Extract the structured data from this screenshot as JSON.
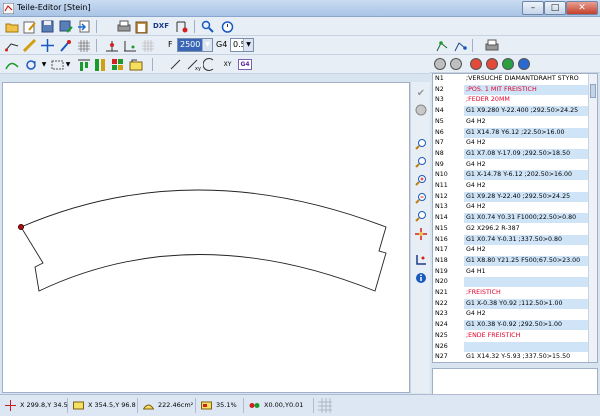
{
  "window": {
    "title": "Teile-Editor [Stein]"
  },
  "toolbar": {
    "feed_label": "F",
    "feed_value": "2500",
    "g4_label": "G4",
    "g4_value": "0.5",
    "dxf_label": "DXF",
    "xy_label": "XY",
    "g4_button_label": "G4"
  },
  "nc_list": {
    "rows": [
      {
        "n": "N1",
        "text": ";VERSUCHE DIAMANTDRAHT  STYRO",
        "red": false,
        "alt": false
      },
      {
        "n": "N2",
        "text": ";POS. 1 MIT FREISTICH",
        "red": true,
        "alt": true
      },
      {
        "n": "N3",
        "text": ";FEDER 20MM",
        "red": true,
        "alt": false
      },
      {
        "n": "N4",
        "text": "G1 X9.280 Y-22.400 ;292.50>24.25",
        "red": false,
        "alt": true
      },
      {
        "n": "N5",
        "text": "G4 H2",
        "red": false,
        "alt": false
      },
      {
        "n": "N6",
        "text": "G1 X14.78 Y6.12 ;22.50>16.00",
        "red": false,
        "alt": true
      },
      {
        "n": "N7",
        "text": "G4 H2",
        "red": false,
        "alt": false
      },
      {
        "n": "N8",
        "text": "G1 X7.08 Y-17.09 ;292.50>18.50",
        "red": false,
        "alt": true
      },
      {
        "n": "N9",
        "text": "G4 H2",
        "red": false,
        "alt": false
      },
      {
        "n": "N10",
        "text": "G1 X-14.78 Y-6.12 ;202.50>16.00",
        "red": false,
        "alt": true
      },
      {
        "n": "N11",
        "text": "G4 H2",
        "red": false,
        "alt": false
      },
      {
        "n": "N12",
        "text": "G1 X9.28 Y-22.40 ;292.50>24.25",
        "red": false,
        "alt": true
      },
      {
        "n": "N13",
        "text": "G4 H2",
        "red": false,
        "alt": false
      },
      {
        "n": "N14",
        "text": "G1 X0.74 Y0.31 F1000;22.50>0.80",
        "red": false,
        "alt": true
      },
      {
        "n": "N15",
        "text": "G2 X296.2 R-387",
        "red": false,
        "alt": false
      },
      {
        "n": "N16",
        "text": "G1 X0.74 Y-0.31 ;337.50>0.80",
        "red": false,
        "alt": true
      },
      {
        "n": "N17",
        "text": "G4 H2",
        "red": false,
        "alt": false
      },
      {
        "n": "N18",
        "text": "G1 X8.80 Y21.25 F500;67.50>23.00",
        "red": false,
        "alt": true
      },
      {
        "n": "N19",
        "text": "G4 H1",
        "red": false,
        "alt": false
      },
      {
        "n": "N20",
        "text": "",
        "red": false,
        "alt": true
      },
      {
        "n": "N21",
        "text": ";FREISTICH",
        "red": true,
        "alt": false
      },
      {
        "n": "N22",
        "text": "G1 X-0.38 Y0.92 ;112.50>1.00",
        "red": false,
        "alt": true
      },
      {
        "n": "N23",
        "text": "G4 H2",
        "red": false,
        "alt": false
      },
      {
        "n": "N24",
        "text": "G1 X0.38 Y-0.92 ;292.50>1.00",
        "red": false,
        "alt": true
      },
      {
        "n": "N25",
        "text": ";ENDE FREISTICH",
        "red": true,
        "alt": false
      },
      {
        "n": "N26",
        "text": "",
        "red": false,
        "alt": true
      },
      {
        "n": "N27",
        "text": "G1 X14.32 Y-5.93 ;337.50>15.50",
        "red": false,
        "alt": false
      }
    ]
  },
  "status": {
    "cursor": "X 299.8,Y  34.5",
    "size": "X 354.5,Y  96.8",
    "area": "222.46cm²",
    "percent": "35.1%",
    "offset": "X0.00,Y0.01"
  },
  "colors": {
    "accent": "#3a67b5",
    "row_highlight": "#cfe4f7",
    "comment_red": "#e0002a"
  }
}
